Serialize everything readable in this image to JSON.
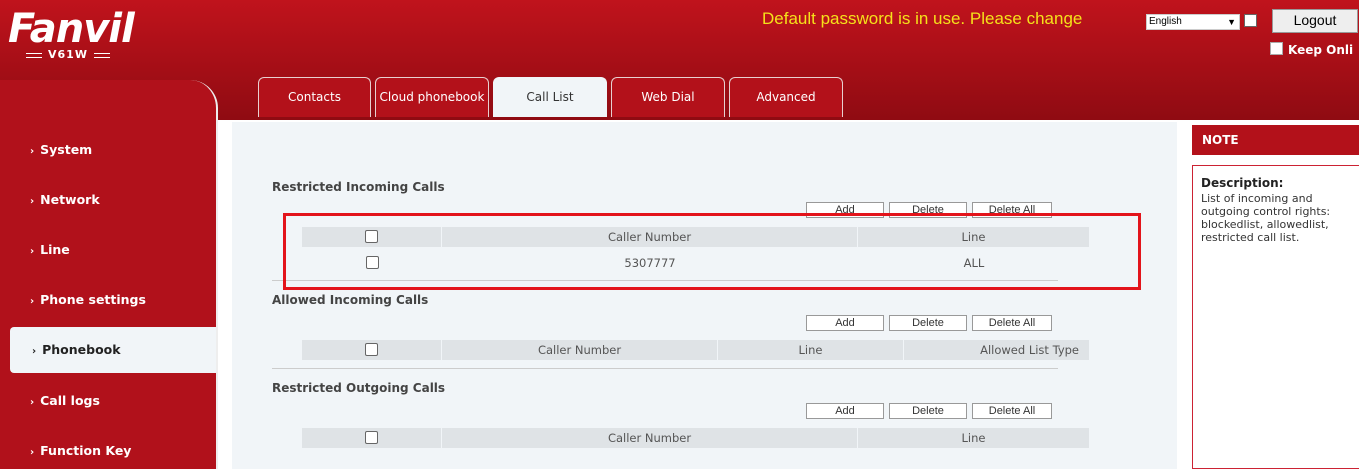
{
  "brand": {
    "logo": "Fanvil",
    "model": "V61W"
  },
  "header": {
    "warning": "Default password is in use. Please change",
    "language": "English",
    "logout_label": "Logout",
    "keep_online_label": "Keep Onli"
  },
  "tabs": [
    {
      "label": "Contacts",
      "active": false
    },
    {
      "label": "Cloud phonebook",
      "active": false
    },
    {
      "label": "Call List",
      "active": true
    },
    {
      "label": "Web Dial",
      "active": false
    },
    {
      "label": "Advanced",
      "active": false
    }
  ],
  "sidebar": {
    "items": [
      {
        "label": "System"
      },
      {
        "label": "Network"
      },
      {
        "label": "Line"
      },
      {
        "label": "Phone settings"
      },
      {
        "label": "Phonebook",
        "active": true
      },
      {
        "label": "Call logs"
      },
      {
        "label": "Function Key"
      }
    ]
  },
  "buttons": {
    "add": "Add",
    "delete": "Delete",
    "delete_all": "Delete All"
  },
  "sections": {
    "restricted_incoming": {
      "title": "Restricted Incoming Calls",
      "headers": [
        "Caller Number",
        "Line"
      ],
      "rows": [
        {
          "number": "5307777",
          "line": "ALL"
        }
      ]
    },
    "allowed_incoming": {
      "title": "Allowed Incoming Calls",
      "headers": [
        "Caller Number",
        "Line",
        "Allowed List Type"
      ],
      "rows": []
    },
    "restricted_outgoing": {
      "title": "Restricted Outgoing Calls",
      "headers": [
        "Caller Number",
        "Line"
      ],
      "rows": []
    }
  },
  "note": {
    "header": "NOTE",
    "title": "Description:",
    "text": "List of incoming and outgoing control rights: blockedlist, allowedlist, restricted call list."
  },
  "colors": {
    "brand_red": "#b3111a",
    "warning_yellow": "#f5e11a",
    "highlight_red": "#e3141b",
    "content_bg": "#f1f5f8"
  }
}
